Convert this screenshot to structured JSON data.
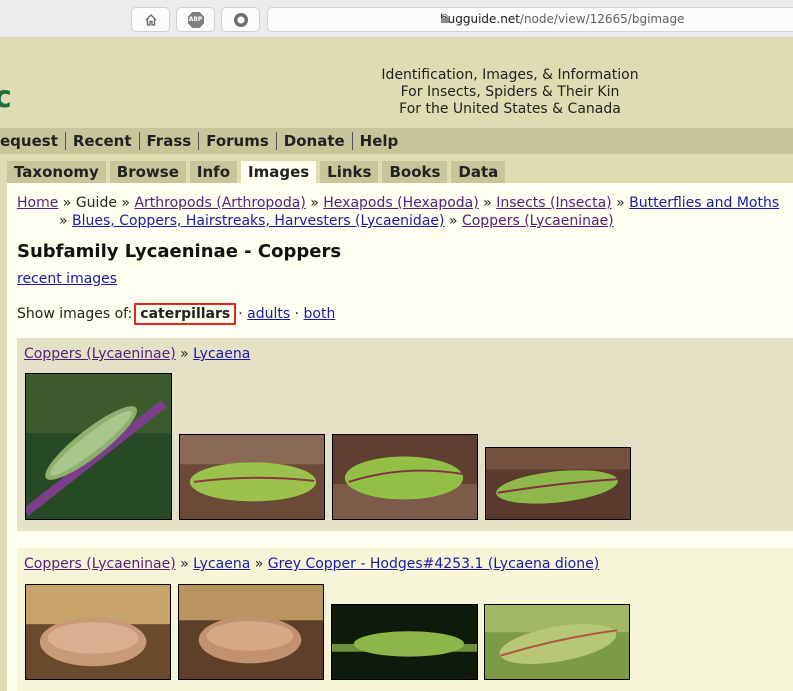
{
  "browser": {
    "url_host": "bugguide.net",
    "url_path": "/node/view/12665/bgimage",
    "icons": [
      "home-icon",
      "adblock-icon",
      "record-icon",
      "lock-icon"
    ],
    "abp_label": "ABP"
  },
  "header": {
    "logo_fragment": "c",
    "tagline": [
      "Identification, Images, & Information",
      "For Insects, Spiders & Their Kin",
      "For the United States & Canada"
    ]
  },
  "menu": [
    "equest",
    "Recent",
    "Frass",
    "Forums",
    "Donate",
    "Help"
  ],
  "tabs": [
    "Taxonomy",
    "Browse",
    "Info",
    "Images",
    "Links",
    "Books",
    "Data"
  ],
  "active_tab": "Images",
  "breadcrumb": {
    "home": "Home",
    "guide": "Guide",
    "sep": "»",
    "arthropods": "Arthropods (Arthropoda)",
    "hexapods": "Hexapods (Hexapoda)",
    "insects": "Insects (Insecta)",
    "butterflies": "Butterflies and Moths",
    "lycaenidae": "Blues, Coppers, Hairstreaks, Harvesters (Lycaenidae)",
    "coppers": "Coppers (Lycaeninae)"
  },
  "page_title": "Subfamily Lycaeninae - Coppers",
  "recent_images": "recent images",
  "show_images": {
    "label": "Show images of:",
    "selected": "caterpillars",
    "dot": "·",
    "adults": "adults",
    "both": "both"
  },
  "groups": [
    {
      "crumbs": [
        "Coppers (Lycaeninae)",
        "Lycaena"
      ]
    },
    {
      "crumbs": [
        "Coppers (Lycaeninae)",
        "Lycaena",
        "Grey Copper - Hodges#4253.1 (Lycaena dione)"
      ]
    }
  ],
  "colors": {
    "accent_box": "#e02a1f",
    "link": "#1a1aa6",
    "header_bg": "#dfdcb3"
  }
}
